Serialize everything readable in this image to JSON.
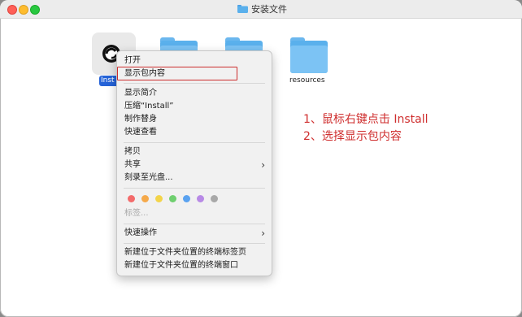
{
  "window": {
    "title": "安装文件"
  },
  "files": [
    {
      "name": "Install",
      "label_visible": "Inst"
    },
    {
      "name": "resources"
    }
  ],
  "context_menu": {
    "open": "打开",
    "show_package_contents": "显示包内容",
    "get_info": "显示简介",
    "compress": "压缩“Install”",
    "make_alias": "制作替身",
    "quick_look": "快速查看",
    "copy": "拷贝",
    "share": "共享",
    "burn": "刻录至光盘...",
    "tags": "标签...",
    "quick_actions": "快速操作",
    "new_terminal_tab": "新建位于文件夹位置的终端标签页",
    "new_terminal_window": "新建位于文件夹位置的终端窗口",
    "tag_colors": [
      "#f36b6b",
      "#f5a94a",
      "#f3d44a",
      "#6fcf6f",
      "#5aa2f0",
      "#b88ae6",
      "#a8a8a8"
    ]
  },
  "annotations": {
    "step1": "1、鼠标右键点击 Install",
    "step2": "2、选择显示包内容",
    "color": "#cf2e2e"
  }
}
